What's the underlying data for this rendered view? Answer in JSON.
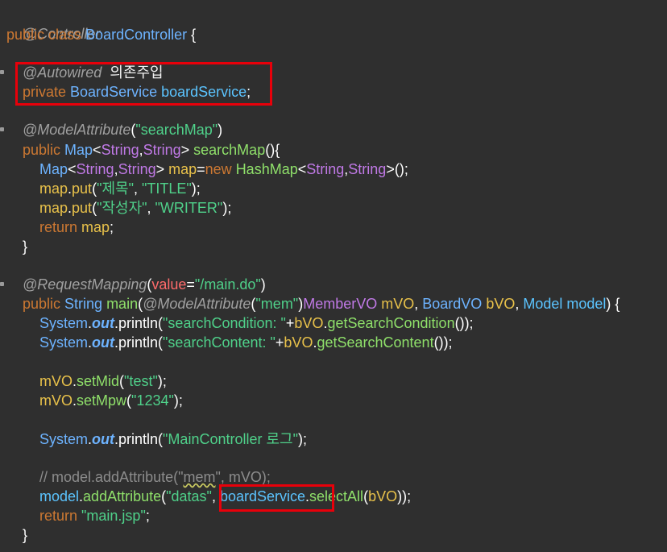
{
  "code": {
    "l1_ann": "@Controller",
    "l2_kw": "public class ",
    "l2_cls": "BoardController",
    "l2_brace": " {",
    "l3_ann": "@Autowired",
    "l3_note": "의존주입",
    "l4_kw": "private ",
    "l4_type": "BoardService ",
    "l4_field": "boardService",
    "l4_semi": ";",
    "l5_ann": "@ModelAttribute",
    "l5_open": "(",
    "l5_str": "\"searchMap\"",
    "l5_close": ")",
    "l6_kw": "public ",
    "l6_map": "Map",
    "l6_lt": "<",
    "l6_s1": "String",
    "l6_comma": ",",
    "l6_s2": "String",
    "l6_gt": "> ",
    "l6_fn": "searchMap",
    "l6_rest": "(){",
    "l7_map": "Map",
    "l7_lt": "<",
    "l7_s1": "String",
    "l7_comma": ",",
    "l7_s2": "String",
    "l7_gt": "> ",
    "l7_var": "map",
    "l7_eq": "=",
    "l7_new": "new ",
    "l7_hm": "HashMap",
    "l7_lt2": "<",
    "l7_s3": "String",
    "l7_comma2": ",",
    "l7_s4": "String",
    "l7_end": ">();",
    "l8_var": "map",
    "l8_dot": ".",
    "l8_fn": "put",
    "l8_open": "(",
    "l8_k": "\"제목\"",
    "l8_c": ", ",
    "l8_v": "\"TITLE\"",
    "l8_end": ");",
    "l9_var": "map",
    "l9_dot": ".",
    "l9_fn": "put",
    "l9_open": "(",
    "l9_k": "\"작성자\"",
    "l9_c": ", ",
    "l9_v": "\"WRITER\"",
    "l9_end": ");",
    "l10_kw": "return ",
    "l10_var": "map",
    "l10_end": ";",
    "l11": "}",
    "l12_ann": "@RequestMapping",
    "l12_open": "(",
    "l12_attr": "value",
    "l12_eq": "=",
    "l12_str": "\"/main.do\"",
    "l12_close": ")",
    "l13_kw": "public ",
    "l13_type": "String ",
    "l13_fn": "main",
    "l13_open": "(",
    "l13_ann": "@ModelAttribute",
    "l13_po": "(",
    "l13_str": "\"mem\"",
    "l13_pc": ")",
    "l13_t1": "MemberVO ",
    "l13_v1": "mVO",
    "l13_c1": ", ",
    "l13_t2": "BoardVO ",
    "l13_v2": "bVO",
    "l13_c2": ", ",
    "l13_t3": "Model ",
    "l13_v3": "model",
    "l13_end": ") {",
    "l14_sys": "System",
    "l14_dot": ".",
    "l14_out": "out",
    "l14_fn": ".println(",
    "l14_str": "\"searchCondition: \"",
    "l14_plus": "+",
    "l14_var": "bVO",
    "l14_dot2": ".",
    "l14_get": "getSearchCondition",
    "l14_end": "());",
    "l15_sys": "System",
    "l15_dot": ".",
    "l15_out": "out",
    "l15_fn": ".println(",
    "l15_str": "\"searchContent: \"",
    "l15_plus": "+",
    "l15_var": "bVO",
    "l15_dot2": ".",
    "l15_get": "getSearchContent",
    "l15_end": "());",
    "l16_var": "mVO",
    "l16_dot": ".",
    "l16_fn": "setMid",
    "l16_open": "(",
    "l16_str": "\"test\"",
    "l16_end": ");",
    "l17_var": "mVO",
    "l17_dot": ".",
    "l17_fn": "setMpw",
    "l17_open": "(",
    "l17_str": "\"1234\"",
    "l17_end": ");",
    "l18_sys": "System",
    "l18_dot": ".",
    "l18_out": "out",
    "l18_fn": ".println(",
    "l18_str": "\"MainController 로그\"",
    "l18_end": ");",
    "l19_a": "// model.addAttribute(\"",
    "l19_b": "mem",
    "l19_c": "\", mVO);",
    "l20_var": "model",
    "l20_dot": ".",
    "l20_fn": "addAttribute",
    "l20_open": "(",
    "l20_str": "\"datas\"",
    "l20_c": ", ",
    "l20_field": "boardService",
    "l20_dot2": ".",
    "l20_fn2": "selectAll",
    "l20_open2": "(",
    "l20_var2": "bVO",
    "l20_end": "));",
    "l21_kw": "return ",
    "l21_str": "\"main.jsp\"",
    "l21_end": ";",
    "l22": "}"
  },
  "colors": {
    "background": "#2f2f2f",
    "highlight_box": "#e8000a"
  }
}
